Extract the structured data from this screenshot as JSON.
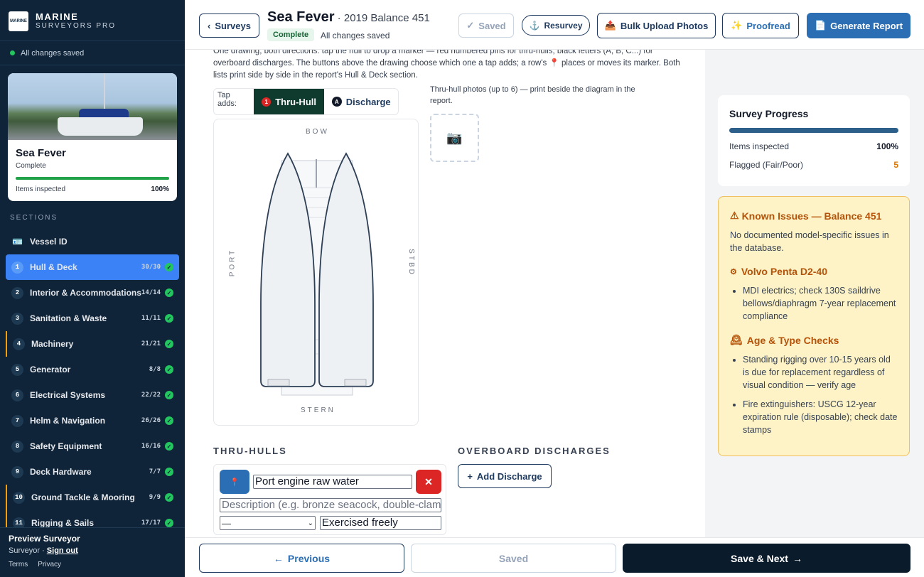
{
  "brand": {
    "line1": "MARINE",
    "line2": "SURVEYORS PRO",
    "logo_text": "MARINE"
  },
  "sidebar": {
    "saved_status": "All changes saved",
    "vessel": {
      "name": "Sea Fever",
      "status": "Complete",
      "stat_label": "Items inspected",
      "stat_value": "100%",
      "progress": 1.0
    },
    "sections_label": "SECTIONS",
    "vessel_id_label": "Vessel ID",
    "items": [
      {
        "num": "1",
        "label": "Hull & Deck",
        "count": "30/30",
        "active": true,
        "flag": false
      },
      {
        "num": "2",
        "label": "Interior & Accommodations",
        "count": "14/14",
        "active": false,
        "flag": false
      },
      {
        "num": "3",
        "label": "Sanitation & Waste",
        "count": "11/11",
        "active": false,
        "flag": false
      },
      {
        "num": "4",
        "label": "Machinery",
        "count": "21/21",
        "active": false,
        "flag": true
      },
      {
        "num": "5",
        "label": "Generator",
        "count": "8/8",
        "active": false,
        "flag": false
      },
      {
        "num": "6",
        "label": "Electrical Systems",
        "count": "22/22",
        "active": false,
        "flag": false
      },
      {
        "num": "7",
        "label": "Helm & Navigation",
        "count": "26/26",
        "active": false,
        "flag": false
      },
      {
        "num": "8",
        "label": "Safety Equipment",
        "count": "16/16",
        "active": false,
        "flag": false
      },
      {
        "num": "9",
        "label": "Deck Hardware",
        "count": "7/7",
        "active": false,
        "flag": false
      },
      {
        "num": "10",
        "label": "Ground Tackle & Mooring",
        "count": "9/9",
        "active": false,
        "flag": true
      },
      {
        "num": "11",
        "label": "Rigging & Sails",
        "count": "17/17",
        "active": false,
        "flag": true
      }
    ],
    "footer": {
      "user": "Preview Surveyor",
      "role": "Surveyor · ",
      "signout": "Sign out",
      "terms": "Terms",
      "privacy": "Privacy"
    }
  },
  "header": {
    "back_label": "Surveys",
    "vessel_name": "Sea Fever",
    "vessel_sub": " · 2019 Balance 451",
    "badge": "Complete",
    "saved_text": "All changes saved",
    "saved_btn": "Saved",
    "resurvey_btn": "Resurvey",
    "bulk_upload_btn": "Bulk Upload Photos",
    "proofread_btn": "Proofread",
    "generate_btn": "Generate Report"
  },
  "main": {
    "intro": "One drawing, both directions: tap the hull to drop a marker — red numbered pins for thru-hulls, black letters (A, B, C...) for overboard discharges. The buttons above the drawing choose which one a tap adds; a row's 📍 places or moves its marker. Both lists print side by side in the report's Hull & Deck section.",
    "tap_adds_label": "Tap adds:",
    "tap_thru_hull": "Thru-Hull",
    "tap_thru_hull_pin": "1",
    "tap_discharge": "Discharge",
    "tap_discharge_pin": "A",
    "photo_note": "Thru-hull photos (up to 6) — print beside the diagram in the report.",
    "diagram": {
      "bow": "BOW",
      "stern": "STERN",
      "port": "PORT",
      "stbd": "STBD"
    },
    "thru_hulls_heading": "THRU-HULLS",
    "discharges_heading": "OVERBOARD DISCHARGES",
    "add_discharge": "Add Discharge",
    "thru_hull_row": {
      "name_value": "Port engine raw water",
      "desc_placeholder": "Description (e.g. bronze seacock, double-clamped)",
      "select_value": "—",
      "condition_value": "Exercised freely"
    }
  },
  "progress": {
    "title": "Survey Progress",
    "bar": 1.0,
    "items_label": "Items inspected",
    "items_value": "100%",
    "flagged_label": "Flagged (Fair/Poor)",
    "flagged_value": "5"
  },
  "issues": {
    "title": "Known Issues — Balance 451",
    "intro": "No documented model-specific issues in the database.",
    "engine_title": "Volvo Penta D2-40",
    "engine_items": [
      "MDI electrics; check 130S saildrive bellows/diaphragm 7-year replacement compliance"
    ],
    "age_title": "Age & Type Checks",
    "age_items": [
      "Standing rigging over 10-15 years old is due for replacement regardless of visual condition — verify age",
      "Fire extinguishers: USCG 12-year expiration rule (disposable); check date stamps"
    ]
  },
  "bottom": {
    "previous": "Previous",
    "saved": "Saved",
    "save_next": "Save & Next"
  },
  "colors": {
    "accent": "#2c6eb3",
    "sidebar": "#0f2438",
    "active": "#3b82f6",
    "danger": "#dc2626",
    "success": "#22c55e",
    "warning_bg": "#fef3c7"
  }
}
